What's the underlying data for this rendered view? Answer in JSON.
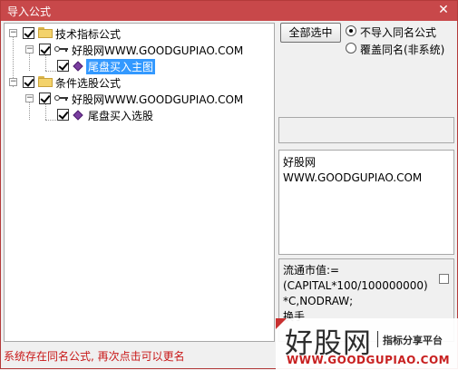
{
  "window": {
    "title": "导入公式",
    "close_glyph": "✕"
  },
  "tree": {
    "indicator_group": "技术指标公式",
    "indicator_source": "好股网WWW.GOODGUPIAO.COM",
    "indicator_item": "尾盘买入主图",
    "selection_group": "条件选股公式",
    "selection_source": "好股网WWW.GOODGUPIAO.COM",
    "selection_item": "尾盘买入选股"
  },
  "controls": {
    "select_all_label": "全部选中",
    "radio_skip_label": "不导入同名公式",
    "radio_overwrite_label": "覆盖同名(非系统)"
  },
  "info": {
    "line1": "好股网",
    "line2": "WWW.GOODGUPIAO.COM"
  },
  "code": {
    "line1": "流通市值:=",
    "line2": "(CAPITAL*100/100000000)",
    "line3": "*C,NODRAW;",
    "line4": "换手"
  },
  "status_text": "系统存在同名公式, 再次点击可以更名",
  "watermark": {
    "brand": "好股网",
    "tagline": "指标分享平台",
    "url": "WWW.GOODGUPIAO.COM"
  },
  "colors": {
    "titlebar": "#c8484a",
    "status": "#c81818",
    "selection": "#3399ff"
  }
}
